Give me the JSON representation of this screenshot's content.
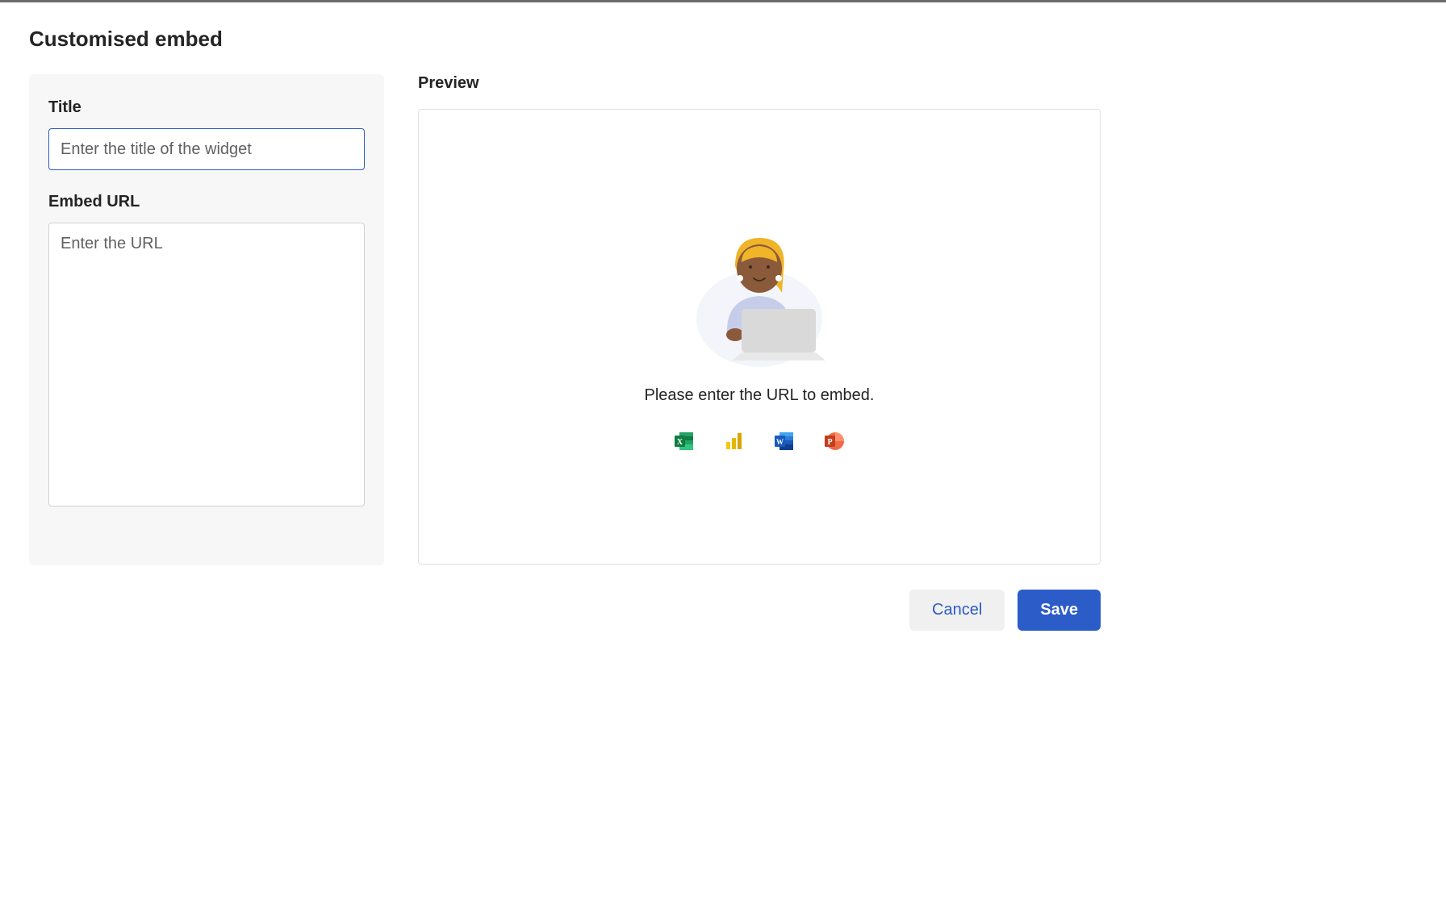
{
  "page_title": "Customised embed",
  "form": {
    "title_label": "Title",
    "title_placeholder": "Enter the title of the widget",
    "title_value": "",
    "url_label": "Embed URL",
    "url_placeholder": "Enter the URL",
    "url_value": ""
  },
  "preview": {
    "heading": "Preview",
    "message": "Please enter the URL to embed.",
    "apps": [
      "excel",
      "powerbi",
      "word",
      "powerpoint"
    ]
  },
  "actions": {
    "cancel_label": "Cancel",
    "save_label": "Save"
  }
}
